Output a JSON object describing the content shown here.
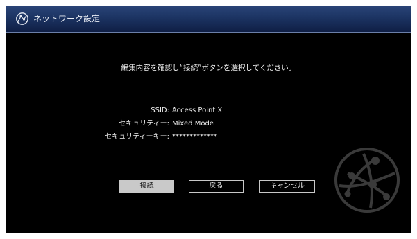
{
  "header": {
    "title": "ネットワーク設定",
    "icon": "network-settings-icon"
  },
  "instruction": "編集内容を確認し“接続”ボタンを選択してください。",
  "info": [
    {
      "label": "SSID:",
      "value": "Access Point X"
    },
    {
      "label": "セキュリティー:",
      "value": "Mixed Mode"
    },
    {
      "label": "セキュリティーキー:",
      "value": "*************"
    }
  ],
  "buttons": {
    "connect": "接続",
    "back": "戻る",
    "cancel": "キャンセル",
    "selected": "connect"
  },
  "decor": {
    "globe_icon": "globe-network-icon"
  },
  "colors": {
    "header_top": "#2a4578",
    "header_bottom": "#0f1f45",
    "background": "#000000",
    "selected_button": "#c9c9c9",
    "text": "#f0f0f0"
  }
}
